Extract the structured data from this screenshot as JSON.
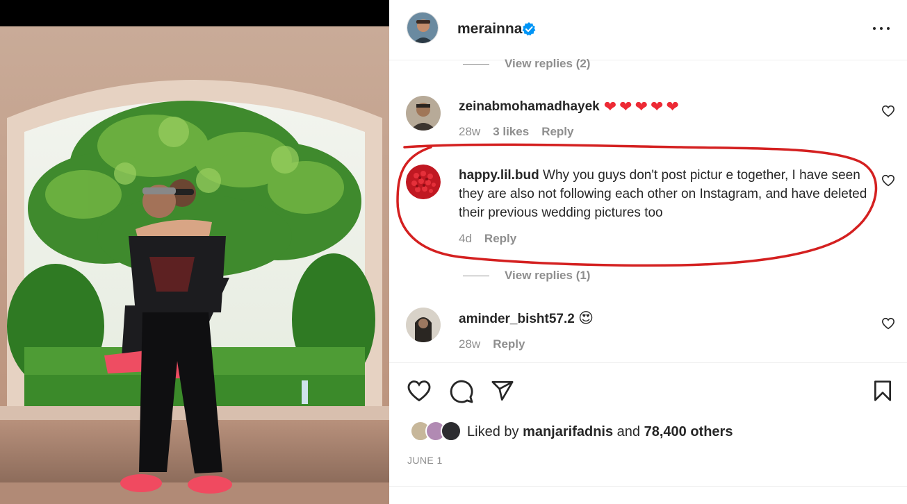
{
  "post": {
    "username": "merainna",
    "date": "JUNE 1"
  },
  "comments": [
    {
      "username": "zeinabmohamadhayek",
      "text": "",
      "emoji": "❤❤❤❤❤",
      "time": "28w",
      "likes": "3 likes",
      "reply": "Reply"
    },
    {
      "username": "happy.lil.bud",
      "text": "Why you guys don't post pictur e together, I have seen they are also not following each other on Instagram, and have deleted their previous wedding pictures too",
      "time": "4d",
      "reply": "Reply"
    },
    {
      "username": "aminder_bisht57.2",
      "emoji": "😍",
      "time": "28w",
      "reply": "Reply"
    }
  ],
  "view_replies": [
    "View replies (2)",
    "View replies (1)"
  ],
  "likes": {
    "prefix": "Liked by",
    "user": "manjarifadnis",
    "connector": "and",
    "others": "78,400 others"
  },
  "icons": {
    "more": "more-options-icon",
    "verified": "verified-badge-icon",
    "like": "heart-icon",
    "comment": "comment-icon",
    "share": "share-icon",
    "save": "bookmark-icon"
  },
  "colors": {
    "text": "#262626",
    "muted": "#8e8e8e",
    "verified": "#0095f6",
    "heart": "#ed2a35",
    "annotation": "#d42020"
  }
}
